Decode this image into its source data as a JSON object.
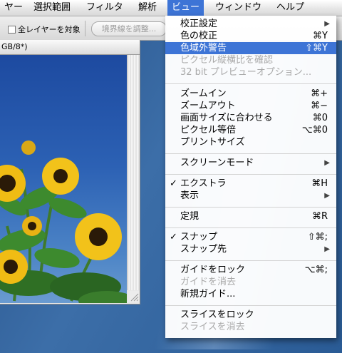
{
  "menubar": {
    "items": [
      {
        "label": "ヤー"
      },
      {
        "label": "選択範囲"
      },
      {
        "label": "フィルタ"
      },
      {
        "label": "解析"
      },
      {
        "label": "ビュー"
      },
      {
        "label": "ウィンドウ"
      },
      {
        "label": "ヘルプ"
      }
    ]
  },
  "options_bar": {
    "checkbox_label": "全レイヤーを対象",
    "button_label": "境界線を調整..."
  },
  "document": {
    "title": "GB/8*)"
  },
  "view_menu": {
    "items": [
      {
        "label": "校正設定",
        "shortcut": "",
        "submenu": true
      },
      {
        "label": "色の校正",
        "shortcut": "⌘Y"
      },
      {
        "label": "色域外警告",
        "shortcut": "⇧⌘Y",
        "highlighted": true
      },
      {
        "label": "ピクセル縦横比を確認",
        "shortcut": "",
        "disabled": true
      },
      {
        "label": "32 bit プレビューオプション...",
        "shortcut": "",
        "disabled": true
      },
      {
        "label": "ズームイン",
        "shortcut": "⌘+"
      },
      {
        "label": "ズームアウト",
        "shortcut": "⌘−"
      },
      {
        "label": "画面サイズに合わせる",
        "shortcut": "⌘0"
      },
      {
        "label": "ピクセル等倍",
        "shortcut": "⌥⌘0"
      },
      {
        "label": "プリントサイズ",
        "shortcut": ""
      },
      {
        "label": "スクリーンモード",
        "shortcut": "",
        "submenu": true
      },
      {
        "label": "エクストラ",
        "shortcut": "⌘H",
        "checked": true
      },
      {
        "label": "表示",
        "shortcut": "",
        "submenu": true
      },
      {
        "label": "定規",
        "shortcut": "⌘R"
      },
      {
        "label": "スナップ",
        "shortcut": "⇧⌘;",
        "checked": true
      },
      {
        "label": "スナップ先",
        "shortcut": "",
        "submenu": true
      },
      {
        "label": "ガイドをロック",
        "shortcut": "⌥⌘;"
      },
      {
        "label": "ガイドを消去",
        "shortcut": "",
        "disabled": true
      },
      {
        "label": "新規ガイド...",
        "shortcut": ""
      },
      {
        "label": "スライスをロック",
        "shortcut": ""
      },
      {
        "label": "スライスを消去",
        "shortcut": "",
        "disabled": true
      }
    ],
    "check_mark": "✓",
    "submenu_arrow": "▶"
  }
}
